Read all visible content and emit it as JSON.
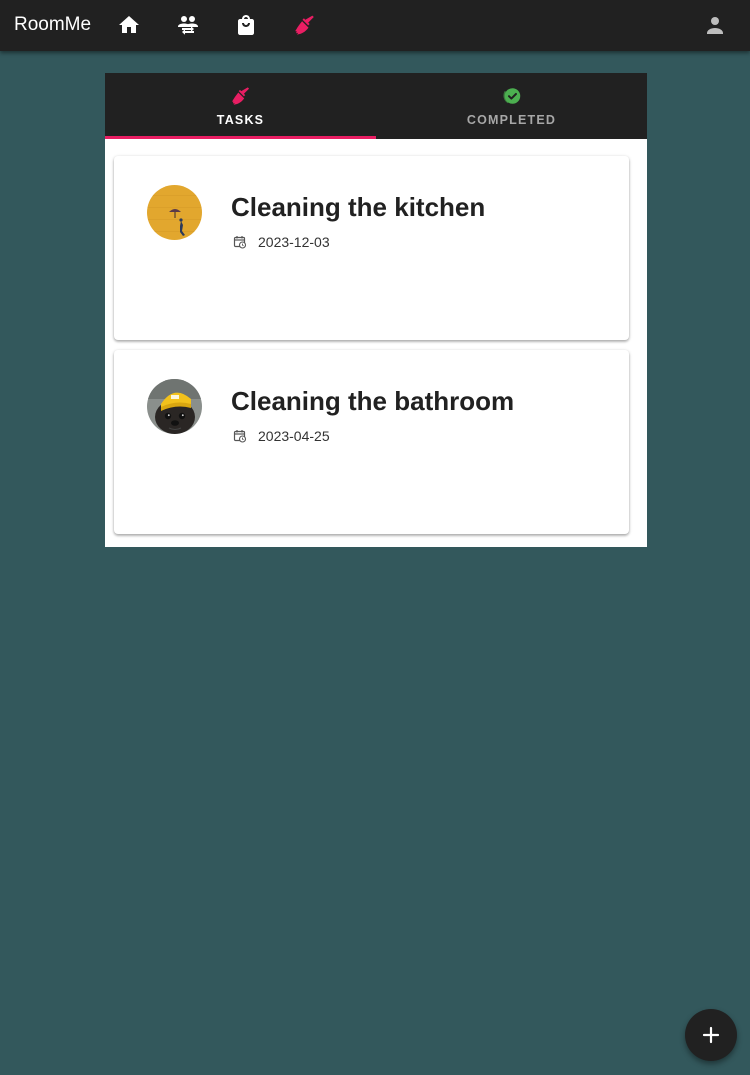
{
  "app": {
    "title": "RoomMe"
  },
  "nav": [
    {
      "name": "home",
      "icon": "home-icon",
      "active": false
    },
    {
      "name": "roommates",
      "icon": "people-swap-icon",
      "active": false
    },
    {
      "name": "shopping",
      "icon": "shopping-bag-icon",
      "active": false
    },
    {
      "name": "tasks",
      "icon": "broom-icon",
      "active": true
    },
    {
      "name": "account",
      "icon": "person-icon",
      "active": false
    }
  ],
  "tabs": [
    {
      "label": "TASKS",
      "icon": "broom-icon",
      "selected": true
    },
    {
      "label": "COMPLETED",
      "icon": "check-circle-icon",
      "selected": false
    }
  ],
  "tasks": [
    {
      "title": "Cleaning the kitchen",
      "date": "2023-12-03",
      "avatar": "yellow-wall-avatar"
    },
    {
      "title": "Cleaning the bathroom",
      "date": "2023-04-25",
      "avatar": "pug-avatar"
    }
  ],
  "fab": {
    "icon": "plus-icon"
  },
  "colors": {
    "background": "#33585c",
    "appbar": "#212121",
    "accent": "#e91e63",
    "completed_check": "#4caf50",
    "card": "#ffffff"
  }
}
